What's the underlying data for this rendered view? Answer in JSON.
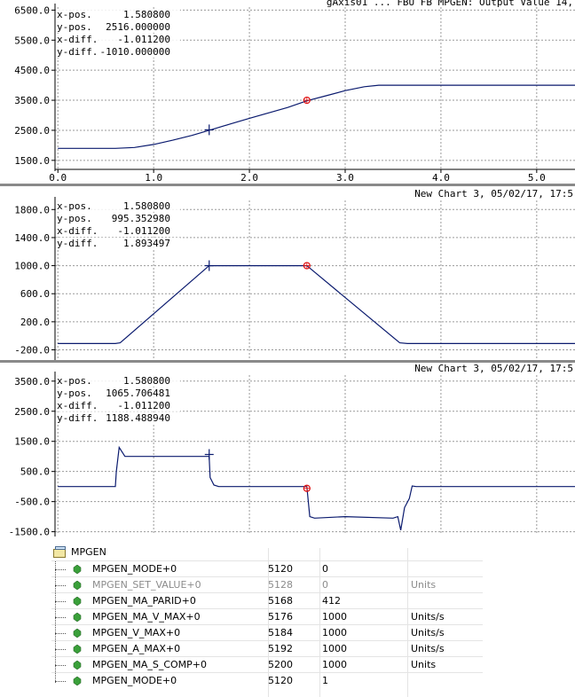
{
  "charts": [
    {
      "header": "gAxis01 ... FBU FB MPGEN: Output Value 14,",
      "y_ticks": [
        {
          "v": 6500,
          "label": "6500.0"
        },
        {
          "v": 5500,
          "label": "5500.0"
        },
        {
          "v": 4500,
          "label": "4500.0"
        },
        {
          "v": 3500,
          "label": "3500.0"
        },
        {
          "v": 2500,
          "label": "2500.0"
        },
        {
          "v": 1500,
          "label": "1500.0"
        }
      ],
      "x_ticks": [
        "0.0",
        "1.0",
        "2.0",
        "3.0",
        "4.0",
        "5.0"
      ],
      "readout": [
        {
          "label": "x-pos.",
          "value": "1.580800"
        },
        {
          "label": "y-pos.",
          "value": "2516.000000"
        },
        {
          "label": "x-diff.",
          "value": "-1.011200"
        },
        {
          "label": "y-diff.",
          "value": "-1010.000000"
        }
      ]
    },
    {
      "header": "New Chart 3, 05/02/17, 17:5",
      "y_ticks": [
        {
          "v": 1800,
          "label": "1800.0"
        },
        {
          "v": 1400,
          "label": "1400.0"
        },
        {
          "v": 1000,
          "label": "1000.0"
        },
        {
          "v": 600,
          "label": "600.0"
        },
        {
          "v": 200,
          "label": "200.0"
        },
        {
          "v": -200,
          "label": "-200.0"
        }
      ],
      "readout": [
        {
          "label": "x-pos.",
          "value": "1.580800"
        },
        {
          "label": "y-pos.",
          "value": "995.352980"
        },
        {
          "label": "x-diff.",
          "value": "-1.011200"
        },
        {
          "label": "y-diff.",
          "value": "1.893497"
        }
      ]
    },
    {
      "header": "New Chart 3, 05/02/17, 17:5",
      "y_ticks": [
        {
          "v": 3500,
          "label": "3500.0"
        },
        {
          "v": 2500,
          "label": "2500.0"
        },
        {
          "v": 1500,
          "label": "1500.0"
        },
        {
          "v": 500,
          "label": "500.0"
        },
        {
          "v": -500,
          "label": "-500.0"
        },
        {
          "v": -1500,
          "label": "-1500.0"
        }
      ],
      "readout": [
        {
          "label": "x-pos.",
          "value": "1.580800"
        },
        {
          "label": "y-pos.",
          "value": "1065.706481"
        },
        {
          "label": "x-diff.",
          "value": "-1.011200"
        },
        {
          "label": "y-diff.",
          "value": "1188.488940"
        }
      ]
    }
  ],
  "chart_data": [
    {
      "type": "line",
      "xlim": [
        -0.03,
        5.4
      ],
      "ylim": [
        1200,
        6600
      ],
      "grid": true,
      "x": [
        0,
        0.6,
        0.8,
        1.0,
        1.2,
        1.4,
        1.6,
        1.8,
        2.0,
        2.2,
        2.4,
        2.6,
        2.8,
        3.0,
        3.2,
        3.35,
        3.5,
        4.0,
        5.0,
        5.4
      ],
      "values": [
        1900,
        1900,
        1930,
        2030,
        2170,
        2330,
        2520,
        2710,
        2900,
        3080,
        3260,
        3480,
        3650,
        3820,
        3950,
        4000,
        4000,
        4000,
        4000,
        4000
      ],
      "cursor_cross": [
        1.58,
        2516
      ],
      "cursor_circle": [
        2.6,
        3500
      ]
    },
    {
      "type": "line",
      "xlim": [
        -0.03,
        5.4
      ],
      "ylim": [
        -320,
        1930
      ],
      "grid": true,
      "x": [
        0,
        0.6,
        0.65,
        1.58,
        2.6,
        3.57,
        3.65,
        5.4
      ],
      "values": [
        -110,
        -110,
        -100,
        1000,
        1000,
        -100,
        -110,
        -110
      ],
      "cursor_cross": [
        1.58,
        1000
      ],
      "cursor_circle": [
        2.6,
        1000
      ]
    },
    {
      "type": "line",
      "xlim": [
        -0.03,
        5.4
      ],
      "ylim": [
        -1600,
        3700
      ],
      "grid": true,
      "x": [
        0,
        0.6,
        0.61,
        0.64,
        0.7,
        1.0,
        1.5,
        1.58,
        1.59,
        1.63,
        1.68,
        2.0,
        2.55,
        2.6,
        2.63,
        2.68,
        3.0,
        3.5,
        3.55,
        3.58,
        3.62,
        3.67,
        3.7,
        3.74,
        4.0,
        5.4
      ],
      "values": [
        0,
        0,
        500,
        1300,
        1000,
        1000,
        1000,
        1000,
        300,
        50,
        0,
        0,
        0,
        0,
        -1000,
        -1050,
        -1000,
        -1050,
        -1000,
        -1450,
        -700,
        -400,
        20,
        0,
        0,
        0
      ],
      "cursor_cross": [
        1.58,
        1065
      ],
      "cursor_circle": [
        2.6,
        -60
      ]
    }
  ],
  "table": {
    "root": "MPGEN",
    "rows": [
      {
        "name": "MPGEN_MODE+0",
        "addr": "5120",
        "value": "0",
        "unit": ""
      },
      {
        "name": "MPGEN_SET_VALUE+0",
        "addr": "5128",
        "value": "0",
        "unit": "Units"
      },
      {
        "name": "MPGEN_MA_PARID+0",
        "addr": "5168",
        "value": "412",
        "unit": ""
      },
      {
        "name": "MPGEN_MA_V_MAX+0",
        "addr": "5176",
        "value": "1000",
        "unit": "Units/s"
      },
      {
        "name": "MPGEN_V_MAX+0",
        "addr": "5184",
        "value": "1000",
        "unit": "Units/s"
      },
      {
        "name": "MPGEN_A_MAX+0",
        "addr": "5192",
        "value": "1000",
        "unit": "Units/s"
      },
      {
        "name": "MPGEN_MA_S_COMP+0",
        "addr": "5200",
        "value": "1000",
        "unit": "Units"
      },
      {
        "name": "MPGEN_MODE+0",
        "addr": "5120",
        "value": "1",
        "unit": ""
      }
    ]
  },
  "colors": {
    "trace": "#0a1a6e",
    "grid": "#9a9a9a",
    "cursor_circle": "#e01010",
    "leaf": "#3aa03a"
  }
}
